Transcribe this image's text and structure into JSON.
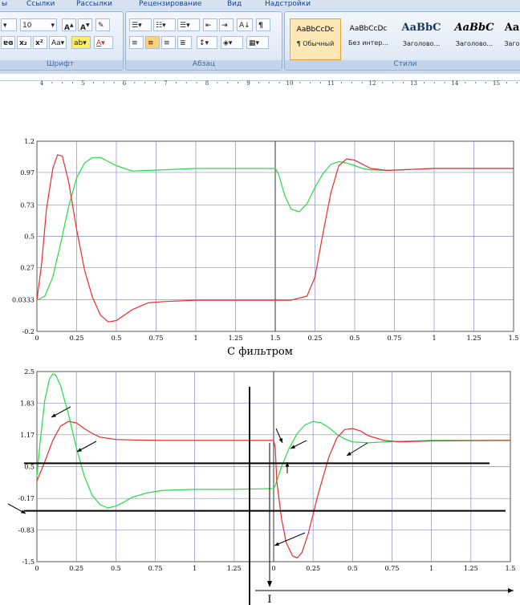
{
  "ribbon": {
    "menu": [
      "ы",
      "Ссылки",
      "Рассылки",
      "Рецензирование",
      "Вид",
      "Надстройки"
    ],
    "font_size_value": "10",
    "font_group_label": "Шрифт",
    "paragraph_group_label": "Абзац",
    "styles_group_label": "Стили",
    "styles": [
      {
        "sample": "AaBbCcDc",
        "name": "¶ Обычный"
      },
      {
        "sample": "AaBbCcDc",
        "name": "Без интер..."
      },
      {
        "sample": "AaBbC",
        "name": "Заголово..."
      },
      {
        "sample": "AaBbC",
        "name": "Заголово..."
      },
      {
        "sample": "Aa",
        "name": "Заго"
      }
    ],
    "ruler_numbers": [
      "4",
      "5",
      "6",
      "7",
      "8",
      "9",
      "10",
      "11",
      "12",
      "13",
      "14",
      "15"
    ]
  },
  "caption": "С фильтром",
  "marker_label": "I",
  "colors": {
    "green": "#22dd44",
    "red": "#ee2a2a",
    "grid": "#8a8acc"
  },
  "chart_data": [
    {
      "type": "line",
      "ylim": [
        -0.2,
        1.2
      ],
      "y_ticks": [
        "1.2",
        "0.97",
        "0.73",
        "0.5",
        "0.27",
        "0.0333",
        "-0.2"
      ],
      "y_tick_values": [
        1.2,
        0.97,
        0.73,
        0.5,
        0.27,
        0.0333,
        -0.2
      ],
      "x_ticks": [
        "0",
        "0.25",
        "0.5",
        "0.75",
        "1",
        "1.25",
        "1.5",
        "0.25",
        "0.5",
        "0.75",
        "1",
        "1.25",
        "1.5"
      ],
      "x_tick_values": [
        0,
        0.25,
        0.5,
        0.75,
        1,
        1.25,
        1.5,
        1.75,
        2.0,
        2.25,
        2.5,
        2.75,
        3.0
      ],
      "xlim": [
        0,
        3.0
      ],
      "series": [
        {
          "color": "green",
          "x": [
            0,
            0.05,
            0.1,
            0.15,
            0.2,
            0.25,
            0.3,
            0.35,
            0.4,
            0.45,
            0.5,
            0.6,
            0.7,
            0.8,
            1.0,
            1.5,
            1.52,
            1.56,
            1.6,
            1.65,
            1.7,
            1.75,
            1.8,
            1.85,
            1.9,
            1.95,
            2.0,
            2.05,
            2.1,
            2.2,
            2.3,
            2.5,
            3.0
          ],
          "y": [
            0.03,
            0.06,
            0.2,
            0.45,
            0.72,
            0.93,
            1.04,
            1.08,
            1.08,
            1.05,
            1.02,
            0.98,
            0.985,
            0.99,
            1.0,
            1.0,
            0.96,
            0.8,
            0.7,
            0.68,
            0.74,
            0.86,
            0.96,
            1.03,
            1.05,
            1.04,
            1.02,
            1.0,
            0.99,
            0.985,
            0.99,
            1.0,
            1.0
          ]
        },
        {
          "color": "red",
          "x": [
            0,
            0.03,
            0.06,
            0.1,
            0.13,
            0.16,
            0.2,
            0.25,
            0.3,
            0.35,
            0.4,
            0.45,
            0.5,
            0.55,
            0.6,
            0.7,
            0.8,
            1.0,
            1.5,
            1.52,
            1.6,
            1.7,
            1.75,
            1.8,
            1.85,
            1.9,
            1.95,
            2.0,
            2.05,
            2.1,
            2.2,
            2.3,
            2.5,
            3.0
          ],
          "y": [
            0.03,
            0.3,
            0.7,
            1.0,
            1.1,
            1.09,
            0.9,
            0.55,
            0.25,
            0.05,
            -0.08,
            -0.13,
            -0.12,
            -0.08,
            -0.04,
            0.01,
            0.02,
            0.03,
            0.03,
            0.03,
            0.03,
            0.06,
            0.2,
            0.52,
            0.82,
            1.02,
            1.07,
            1.06,
            1.03,
            1.0,
            0.985,
            0.99,
            1.0,
            1.0
          ]
        }
      ]
    },
    {
      "type": "line",
      "ylim": [
        -1.5,
        2.5
      ],
      "y_ticks": [
        "2.5",
        "1.83",
        "1.17",
        "0.5",
        "-0.17",
        "-0.83",
        "-1.5"
      ],
      "y_tick_values": [
        2.5,
        1.83,
        1.17,
        0.5,
        -0.17,
        -0.83,
        -1.5
      ],
      "x_ticks": [
        "0",
        "0.25",
        "0.5",
        "0.75",
        "1",
        "1.25",
        "0",
        "0.25",
        "0.5",
        "0.75",
        "1",
        "1.25",
        "1.5"
      ],
      "x_tick_values": [
        0,
        0.25,
        0.5,
        0.75,
        1,
        1.25,
        1.5,
        1.75,
        2.0,
        2.25,
        2.5,
        2.75,
        3.0
      ],
      "xlim": [
        0,
        3.0
      ],
      "series": [
        {
          "color": "green",
          "x": [
            0,
            0.02,
            0.05,
            0.08,
            0.1,
            0.12,
            0.15,
            0.2,
            0.25,
            0.3,
            0.35,
            0.4,
            0.45,
            0.5,
            0.55,
            0.6,
            0.7,
            0.8,
            1.0,
            1.2,
            1.4,
            1.5,
            1.51,
            1.55,
            1.6,
            1.65,
            1.7,
            1.75,
            1.8,
            1.85,
            1.9,
            1.95,
            2.0,
            2.1,
            2.2,
            2.5,
            3.0
          ],
          "y": [
            0.3,
            1.0,
            1.9,
            2.35,
            2.45,
            2.42,
            2.2,
            1.6,
            0.9,
            0.3,
            -0.1,
            -0.3,
            -0.37,
            -0.33,
            -0.25,
            -0.15,
            -0.05,
            0.0,
            0.02,
            0.02,
            0.03,
            0.04,
            0.1,
            0.5,
            0.9,
            1.2,
            1.38,
            1.45,
            1.42,
            1.32,
            1.18,
            1.08,
            1.02,
            1.0,
            1.02,
            1.05,
            1.05
          ]
        },
        {
          "color": "red",
          "x": [
            0,
            0.05,
            0.1,
            0.15,
            0.2,
            0.25,
            0.3,
            0.35,
            0.4,
            0.5,
            0.6,
            0.8,
            1.0,
            1.2,
            1.5,
            1.51,
            1.52,
            1.55,
            1.58,
            1.62,
            1.65,
            1.68,
            1.72,
            1.78,
            1.85,
            1.9,
            1.95,
            2.0,
            2.05,
            2.1,
            2.2,
            2.3,
            2.5,
            3.0
          ],
          "y": [
            0.2,
            0.6,
            1.05,
            1.35,
            1.45,
            1.42,
            1.3,
            1.2,
            1.12,
            1.07,
            1.06,
            1.05,
            1.05,
            1.05,
            1.05,
            0.9,
            0.2,
            -0.6,
            -1.1,
            -1.38,
            -1.42,
            -1.3,
            -0.9,
            -0.1,
            0.7,
            1.1,
            1.28,
            1.3,
            1.25,
            1.15,
            1.05,
            1.02,
            1.04,
            1.05
          ]
        }
      ],
      "reference_lines_y": [
        0.57,
        -0.43
      ]
    }
  ]
}
